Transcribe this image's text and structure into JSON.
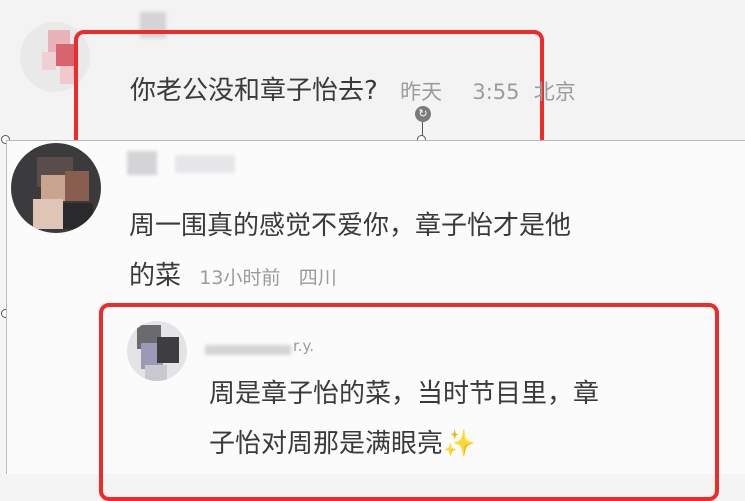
{
  "comments": {
    "first": {
      "text": "你老公没和章子怡去?",
      "time": "昨天",
      "clock": "3:55",
      "location": "北京"
    },
    "second": {
      "line1": "周一围真的感觉不爱你，章子怡才是他",
      "line2": "的菜",
      "time": "13小时前",
      "location": "四川"
    },
    "reply": {
      "name_fragment": "r.y.",
      "line1": "周是章子怡的菜，当时节目里，章",
      "line2": "子怡对周那是满眼亮",
      "emoji": "✨"
    }
  },
  "colors": {
    "highlight": "#ee2a2a",
    "text": "#3a3a3a",
    "meta": "#9b9b9b"
  }
}
